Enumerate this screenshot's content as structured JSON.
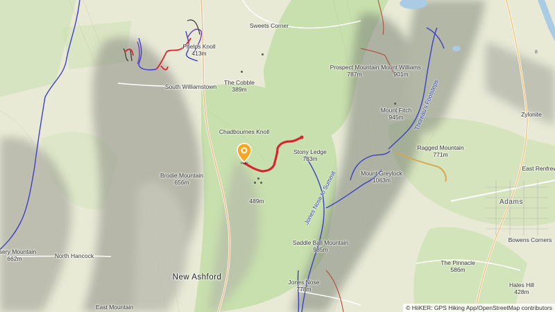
{
  "map": {
    "places": [
      {
        "id": "sweets-corner",
        "name": "Sweets Corner"
      },
      {
        "id": "phelps-knoll",
        "name": "Phelps Knoll",
        "elevation": "413m"
      },
      {
        "id": "south-williamstown",
        "name": "South Williamstown"
      },
      {
        "id": "the-cobble",
        "name": "The Cobble",
        "elevation": "389m"
      },
      {
        "id": "prospect-mountain",
        "name": "Prospect Mountain",
        "elevation": "787m"
      },
      {
        "id": "mount-williams",
        "name": "Mount Williams",
        "elevation": "901m"
      },
      {
        "id": "mount-fitch",
        "name": "Mount Fitch",
        "elevation": "945m"
      },
      {
        "id": "chadbournes-knoll",
        "name": "Chadbournes Knoll"
      },
      {
        "id": "stony-ledge",
        "name": "Stony Ledge",
        "elevation": "783m"
      },
      {
        "id": "ragged-mountain",
        "name": "Ragged Mountain",
        "elevation": "771m"
      },
      {
        "id": "zylonite",
        "name": "Zylonite"
      },
      {
        "id": "brodie-mountain",
        "name": "Brodie Mountain",
        "elevation": "656m"
      },
      {
        "id": "mount-greylock",
        "name": "Mount Greylock",
        "elevation": "1063m"
      },
      {
        "id": "east-renfrew",
        "name": "East Renfrew"
      },
      {
        "id": "peak-489",
        "name": "",
        "elevation": "489m"
      },
      {
        "id": "adams",
        "name": "Adams"
      },
      {
        "id": "saddle-ball",
        "name": "Saddle Ball Mountain",
        "elevation": "985m"
      },
      {
        "id": "bowens-corners",
        "name": "Bowens Corners"
      },
      {
        "id": "misery-mountain",
        "name": "Misery Mountain",
        "elevation": "662m"
      },
      {
        "id": "north-hancock",
        "name": "North Hancock"
      },
      {
        "id": "the-pinnacle",
        "name": "The Pinnacle",
        "elevation": "586m"
      },
      {
        "id": "new-ashford",
        "name": "New Ashford"
      },
      {
        "id": "jones-nose",
        "name": "Jones Nose",
        "elevation": "778m"
      },
      {
        "id": "hales-hill",
        "name": "Hales Hill",
        "elevation": "428m"
      },
      {
        "id": "east-mountain",
        "name": "East Mountain"
      }
    ],
    "trail_labels": {
      "jones_nose_to_summit": "Jones Nose to Summit",
      "thoreaus_footsteps": "Thoreau's Footsteps",
      "route_8": "8"
    },
    "attribution": "© HiiKER: GPS Hiking App/OpenStreetMap contributors",
    "colors": {
      "route_red": "#d9232e",
      "trail_blue": "#3a3fc4",
      "forest_green": "#bcdca3",
      "terrain_base": "#e9ecd9",
      "pin_orange": "#f5a623"
    },
    "icons": {
      "location_pin": "map-pin-icon"
    }
  }
}
